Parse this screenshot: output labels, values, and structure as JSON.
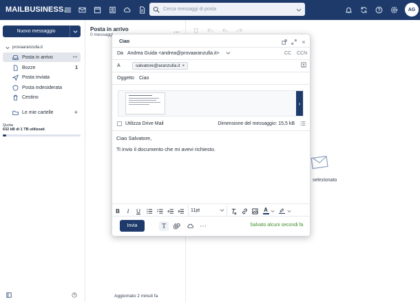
{
  "app": {
    "logo_main": "MAILBUSINESS",
    "logo_dot": "."
  },
  "search": {
    "placeholder": "Cerca messaggi di posta"
  },
  "user": {
    "initials": "AG"
  },
  "sidebar": {
    "new_message": "Nuovo messaggio",
    "account": "provaaranzulla.it",
    "folders": [
      {
        "label": "Posta in arrivo",
        "count": ""
      },
      {
        "label": "Bozze",
        "count": "1"
      },
      {
        "label": "Posta inviata",
        "count": ""
      },
      {
        "label": "Posta indesiderata",
        "count": ""
      },
      {
        "label": "Cestino",
        "count": ""
      }
    ],
    "my_folders": "Le mie cartelle",
    "quota_label": "Quota",
    "quota_detail": "632 kB di 1 TB utilizzati",
    "quota_fraction": 0.04
  },
  "list": {
    "title": "Posta in arrivo",
    "subtitle": "0 messaggi",
    "updated": "Aggiornato 2 minuti fa"
  },
  "reading": {
    "empty_text": "selezionato"
  },
  "compose": {
    "title": "Ciao",
    "from_label": "Da",
    "from_value": "Andrea Guida <andrea@provaaranzulla.it>",
    "cc": "CC",
    "ccn": "CCN",
    "to_label": "A",
    "to_chip": "salvatore@aranzulla.it",
    "subject_label": "Oggetto",
    "subject_value": "Ciao",
    "drive_label": "Utilizza Drive Mail",
    "size_label": "Dimensione del messaggio: 15,5 kB",
    "body_line1": "Ciao Salvatore,",
    "body_line2": "Ti invio il documento che mi avevi richiesto.",
    "font_size": "11pt",
    "send": "Invia",
    "saved_status": "Salvato alcuni secondi fa"
  },
  "colors": {
    "brand": "#1e3a6b",
    "accent_green": "#3f8f2a"
  }
}
